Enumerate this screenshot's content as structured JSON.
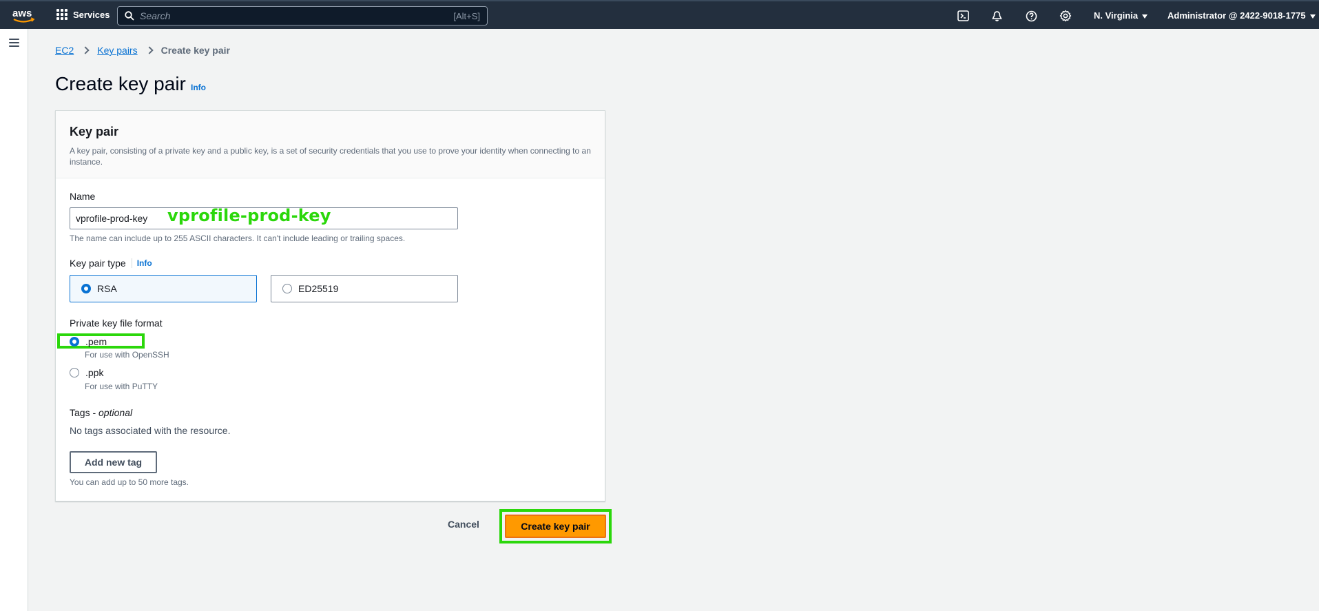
{
  "topnav": {
    "logo_text": "aws",
    "services_label": "Services",
    "search_placeholder": "Search",
    "search_shortcut": "[Alt+S]",
    "region": "N. Virginia",
    "account": "Administrator @ 2422-9018-1775",
    "icons": [
      "cloudshell-icon",
      "bell-icon",
      "help-icon",
      "gear-icon"
    ]
  },
  "breadcrumb": {
    "items": [
      "EC2",
      "Key pairs"
    ],
    "current": "Create key pair"
  },
  "page": {
    "title": "Create key pair",
    "info": "Info"
  },
  "card": {
    "title": "Key pair",
    "description": "A key pair, consisting of a private key and a public key, is a set of security credentials that you use to prove your identity when connecting to an instance."
  },
  "name_field": {
    "label": "Name",
    "value": "vprofile-prod-key",
    "hint": "The name can include up to 255 ASCII characters. It can't include leading or trailing spaces.",
    "annotation": "vprofile-prod-key"
  },
  "key_pair_type": {
    "label": "Key pair type",
    "info": "Info",
    "options": [
      "RSA",
      "ED25519"
    ],
    "selected": "RSA"
  },
  "file_format": {
    "label": "Private key file format",
    "options": [
      {
        "label": ".pem",
        "hint": "For use with OpenSSH"
      },
      {
        "label": ".ppk",
        "hint": "For use with PuTTY"
      }
    ],
    "selected": ".pem"
  },
  "tags": {
    "label": "Tags - ",
    "optional": "optional",
    "empty_text": "No tags associated with the resource.",
    "add_button": "Add new tag",
    "hint": "You can add up to 50 more tags."
  },
  "actions": {
    "cancel": "Cancel",
    "create": "Create key pair"
  },
  "colors": {
    "nav_bg": "#232f3e",
    "primary_button": "#ff9900",
    "link": "#0972d3",
    "annotation_highlight": "#2bd70b"
  }
}
